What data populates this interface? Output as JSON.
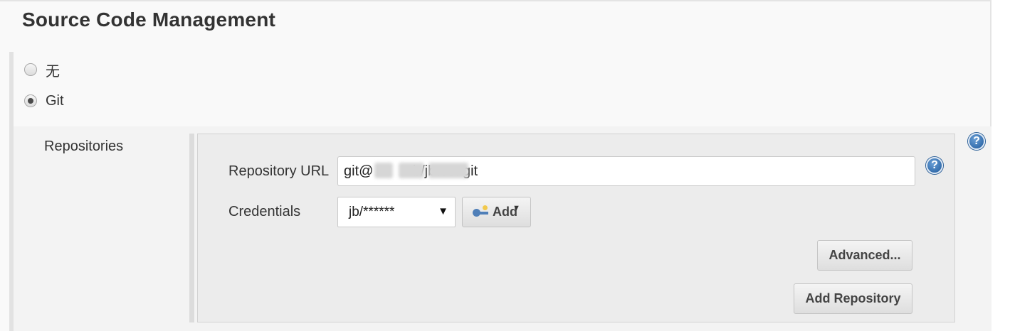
{
  "section": {
    "title": "Source Code Management"
  },
  "scm_options": [
    {
      "label": "无",
      "selected": false
    },
    {
      "label": "Git",
      "selected": true
    }
  ],
  "git": {
    "repositories_label": "Repositories",
    "repository_url_label": "Repository URL",
    "repository_url_value": "git@          b/jbtest.git",
    "credentials_label": "Credentials",
    "credentials_selected": "jb/******",
    "add_button_label": "Add",
    "advanced_button_label": "Advanced...",
    "add_repository_button_label": "Add Repository"
  },
  "icons": {
    "help": "help-icon",
    "key": "key-icon",
    "dropdown": "dropdown-arrow-icon"
  },
  "colors": {
    "help_icon": "#1f5a9c",
    "panel_background": "#ececec"
  }
}
